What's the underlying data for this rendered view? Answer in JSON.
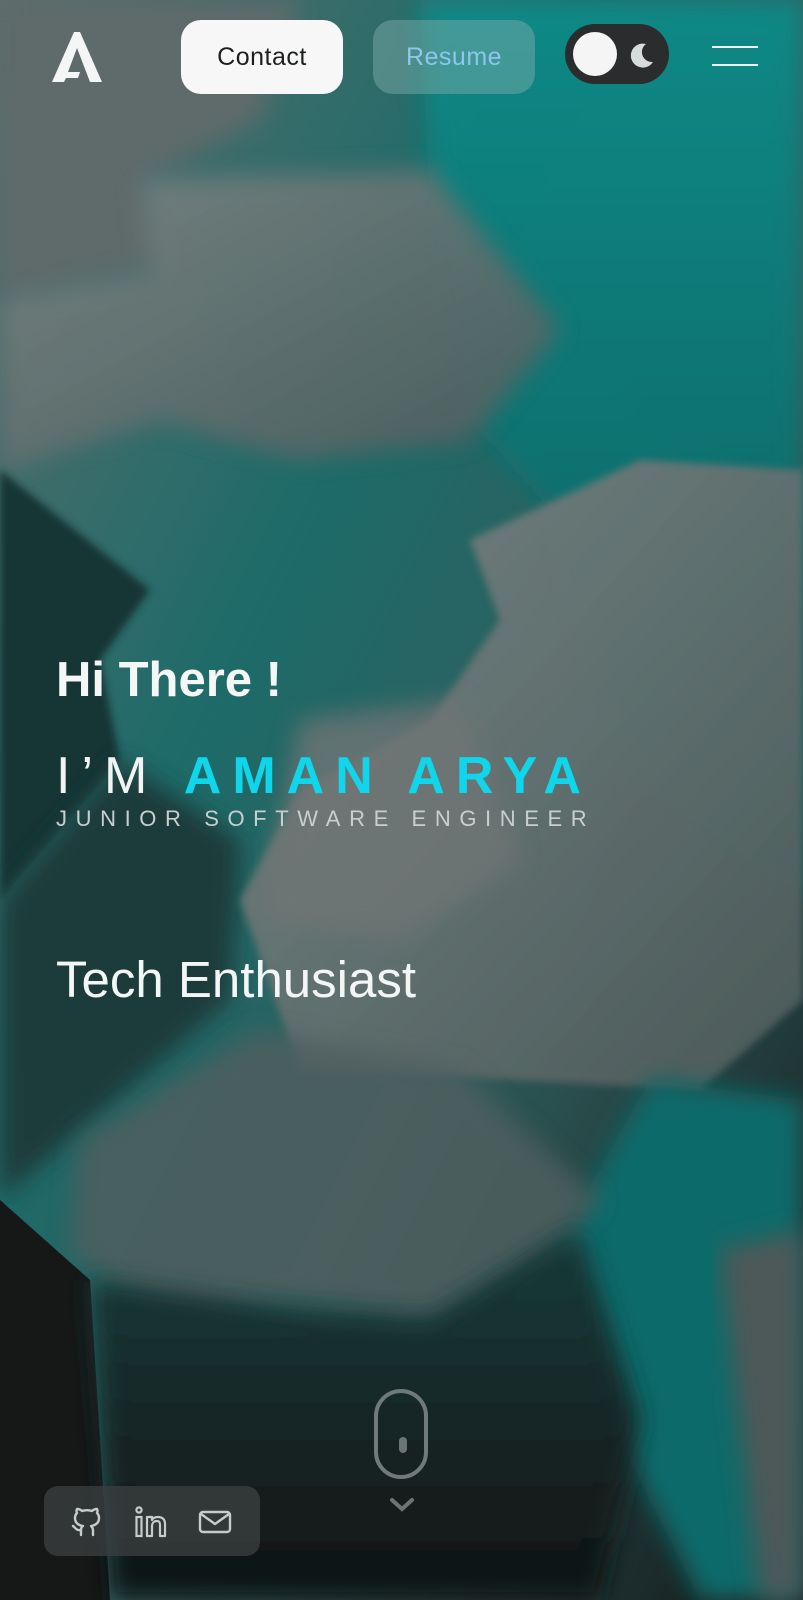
{
  "header": {
    "logo_alt": "A",
    "contact_label": "Contact",
    "resume_label": "Resume",
    "theme_toggle": {
      "state": "dark"
    }
  },
  "hero": {
    "greeting": "Hi There !",
    "intro_prefix": "I’M",
    "name": "AMAN ARYA",
    "role": "JUNIOR SOFTWARE ENGINEER",
    "tagline": "Tech Enthusiast"
  },
  "social": {
    "icons": [
      "github-icon",
      "linkedin-icon",
      "mail-icon"
    ]
  },
  "colors": {
    "accent": "#10d6ec",
    "teal": "#0a7f7f",
    "resume_text": "#8ec6ec"
  }
}
